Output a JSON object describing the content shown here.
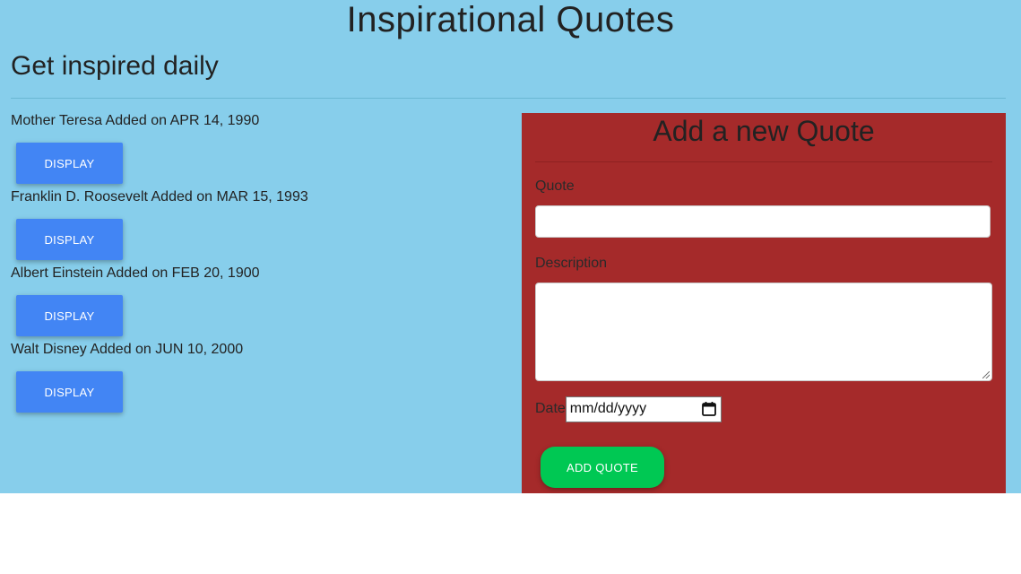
{
  "header": {
    "title": "Inspirational Quotes",
    "subtitle": "Get inspired daily"
  },
  "quotes": [
    {
      "meta": "Mother Teresa Added on APR 14, 1990",
      "button_label": "DISPLAY"
    },
    {
      "meta": "Franklin D. Roosevelt Added on MAR 15, 1993",
      "button_label": "DISPLAY"
    },
    {
      "meta": "Albert Einstein Added on FEB 20, 1900",
      "button_label": "DISPLAY"
    },
    {
      "meta": "Walt Disney Added on JUN 10, 2000",
      "button_label": "DISPLAY"
    }
  ],
  "form": {
    "title": "Add a new Quote",
    "quote_label": "Quote",
    "quote_value": "",
    "description_label": "Description",
    "description_value": "",
    "date_label": "Date",
    "date_placeholder": "mm/dd/yyyy",
    "submit_label": "ADD QUOTE"
  },
  "colors": {
    "page_background": "#87ceeb",
    "form_background": "#a52a2a",
    "display_button": "#4285f4",
    "add_button": "#00c853"
  },
  "icons": {
    "date_picker": "calendar-icon"
  }
}
